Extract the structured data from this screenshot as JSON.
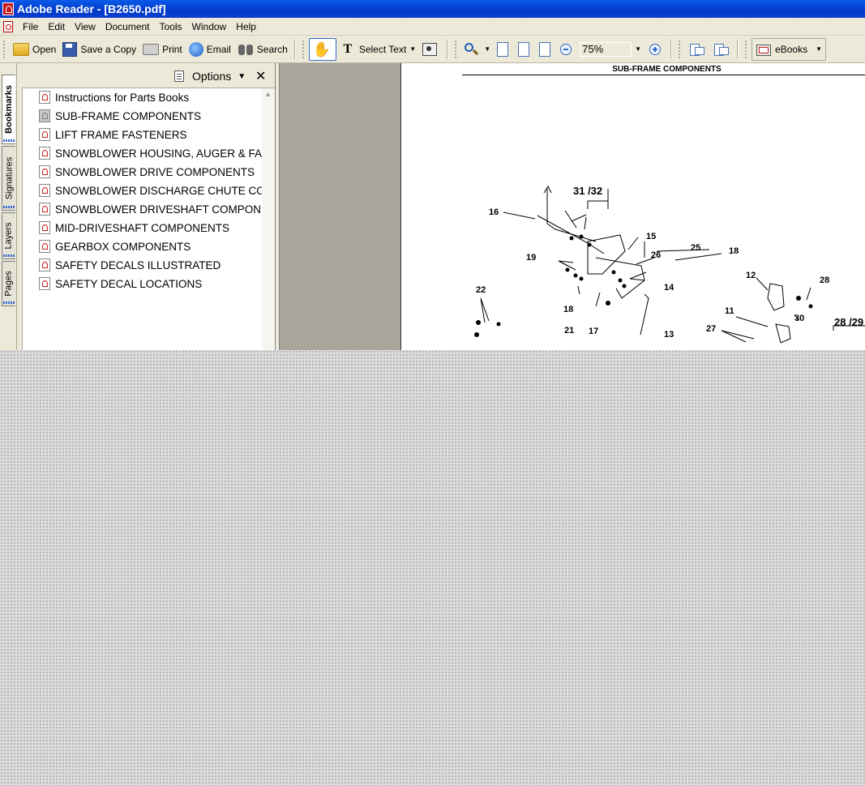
{
  "window": {
    "title": "Adobe Reader - [B2650.pdf]"
  },
  "menu": {
    "items": [
      "File",
      "Edit",
      "View",
      "Document",
      "Tools",
      "Window",
      "Help"
    ]
  },
  "toolbar": {
    "open": "Open",
    "save_copy": "Save a Copy",
    "print": "Print",
    "email": "Email",
    "search": "Search",
    "select_text": "Select Text",
    "zoom_value": "75%",
    "ebooks": "eBooks"
  },
  "nav_tabs": [
    "Bookmarks",
    "Signatures",
    "Layers",
    "Pages"
  ],
  "bookmarks": {
    "options_label": "Options",
    "items": [
      "Instructions for Parts Books",
      "SUB-FRAME COMPONENTS",
      "LIFT FRAME FASTENERS",
      "SNOWBLOWER HOUSING, AUGER & FAN",
      "SNOWBLOWER DRIVE COMPONENTS",
      "SNOWBLOWER DISCHARGE CHUTE COMPONENTS",
      "SNOWBLOWER DRIVESHAFT COMPONENTS",
      "MID-DRIVESHAFT COMPONENTS",
      "GEARBOX COMPONENTS",
      "SAFETY DECALS ILLUSTRATED",
      "SAFETY DECAL LOCATIONS"
    ]
  },
  "document": {
    "page_title": "SUB-FRAME COMPONENTS",
    "callouts": [
      "31 /32",
      "16",
      "15",
      "26",
      "25",
      "18",
      "19",
      "14",
      "18",
      "12",
      "28",
      "22",
      "21",
      "17",
      "13",
      "11",
      "30",
      "27",
      "28 /29"
    ]
  }
}
